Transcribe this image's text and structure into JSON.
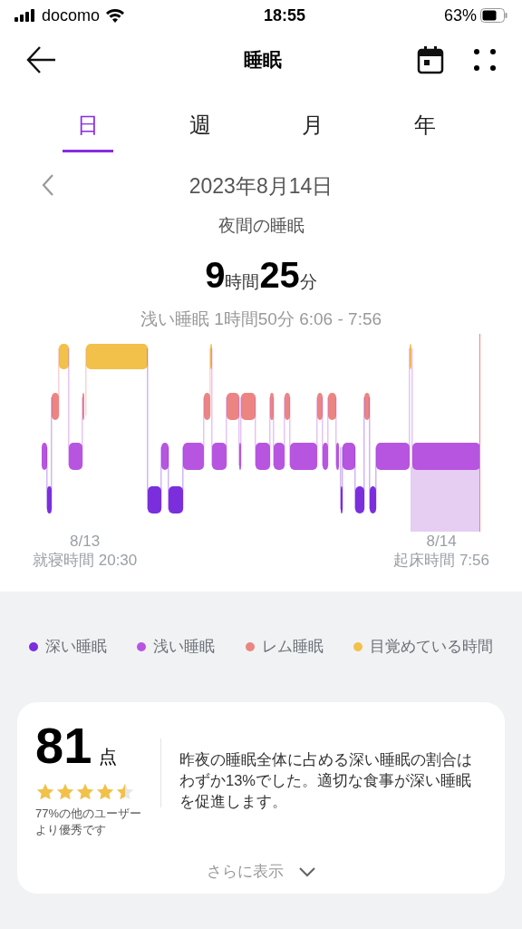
{
  "status_bar": {
    "carrier": "docomo",
    "time": "18:55",
    "battery": "63%"
  },
  "header": {
    "title": "睡眠"
  },
  "tabs": [
    {
      "label": "日",
      "selected": true
    },
    {
      "label": "週",
      "selected": false
    },
    {
      "label": "月",
      "selected": false
    },
    {
      "label": "年",
      "selected": false
    }
  ],
  "date": "2023年8月14日",
  "subtitle": "夜間の睡眠",
  "duration": {
    "hours": "9",
    "hours_unit": "時間",
    "minutes": "25",
    "minutes_unit": "分"
  },
  "selection_label": "浅い睡眠 1時間50分 6:06 - 7:56",
  "start": {
    "date": "8/13",
    "label": "就寝時間 20:30"
  },
  "end": {
    "date": "8/14",
    "label": "起床時間 7:56"
  },
  "legend": [
    {
      "label": "深い睡眠",
      "color": "#7b2fdc"
    },
    {
      "label": "浅い睡眠",
      "color": "#b755e0"
    },
    {
      "label": "レム睡眠",
      "color": "#ec8582"
    },
    {
      "label": "目覚めている時間",
      "color": "#f2c14a"
    }
  ],
  "score": {
    "value": "81",
    "unit": "点",
    "stars": 4.5,
    "rank": "77%の他のユーザーより優秀です",
    "message": "昨夜の睡眠全体に占める深い睡眠の割合はわずか13%でした。適切な食事が深い睡眠を促進します。",
    "more": "さらに表示"
  }
}
